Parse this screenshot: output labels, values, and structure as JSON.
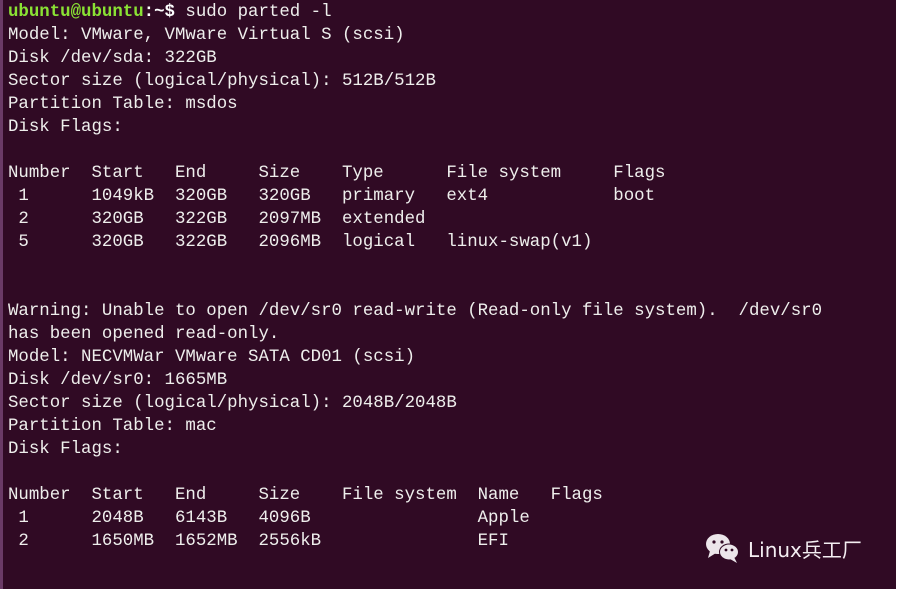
{
  "terminal": {
    "prompt": {
      "user_host": "ubuntu@ubuntu",
      "path": ":~$",
      "command": " sudo parted -l"
    },
    "disk1": {
      "model": "Model: VMware, VMware Virtual S (scsi)",
      "disk": "Disk /dev/sda: 322GB",
      "sector_size": "Sector size (logical/physical): 512B/512B",
      "partition_table": "Partition Table: msdos",
      "disk_flags": "Disk Flags:",
      "table_header": "Number  Start   End     Size    Type      File system     Flags",
      "rows": [
        " 1      1049kB  320GB   320GB   primary   ext4            boot",
        " 2      320GB   322GB   2097MB  extended",
        " 5      320GB   322GB   2096MB  logical   linux-swap(v1)"
      ]
    },
    "warning": [
      "Warning: Unable to open /dev/sr0 read-write (Read-only file system).  /dev/sr0",
      "has been opened read-only."
    ],
    "disk2": {
      "model": "Model: NECVMWar VMware SATA CD01 (scsi)",
      "disk": "Disk /dev/sr0: 1665MB",
      "sector_size": "Sector size (logical/physical): 2048B/2048B",
      "partition_table": "Partition Table: mac",
      "disk_flags": "Disk Flags:",
      "table_header": "Number  Start   End     Size    File system  Name   Flags",
      "rows": [
        " 1      2048B   6143B   4096B                Apple",
        " 2      1650MB  1652MB  2556kB               EFI"
      ]
    }
  },
  "watermark": {
    "icon": "wechat-icon",
    "text": "Linux兵工厂"
  }
}
